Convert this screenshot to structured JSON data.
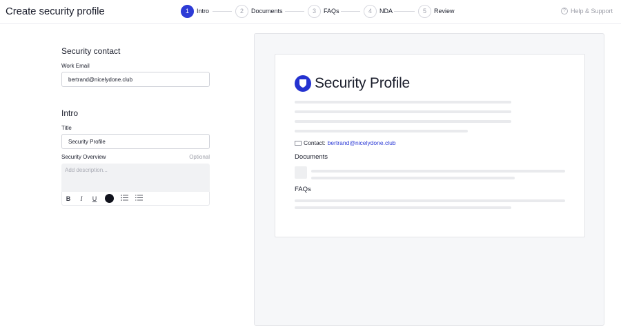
{
  "header": {
    "title": "Create security profile",
    "help_label": "Help & Support",
    "help_icon": "question-icon"
  },
  "stepper": [
    {
      "number": "1",
      "label": "Intro",
      "active": true
    },
    {
      "number": "2",
      "label": "Documents",
      "active": false
    },
    {
      "number": "3",
      "label": "FAQs",
      "active": false
    },
    {
      "number": "4",
      "label": "NDA",
      "active": false
    },
    {
      "number": "5",
      "label": "Review",
      "active": false
    }
  ],
  "form": {
    "security_contact": {
      "title": "Security contact",
      "email_label": "Work Email",
      "email_value": "bertrand@nicelydone.club"
    },
    "intro": {
      "title": "Intro",
      "title_label": "Title",
      "title_value": "Security Profile",
      "overview_label": "Security Overview",
      "overview_optional": "Optional",
      "overview_placeholder": "Add description...",
      "toolbar": {
        "bold": "B",
        "italic": "I",
        "underline": "U",
        "color_value": "#11131d"
      }
    }
  },
  "preview": {
    "title": "Security Profile",
    "contact_label": "Contact:",
    "contact_email": "bertrand@nicelydone.club",
    "documents_heading": "Documents",
    "faqs_heading": "FAQs"
  },
  "colors": {
    "accent": "#2d3bd6",
    "logo": "#2432d0"
  }
}
